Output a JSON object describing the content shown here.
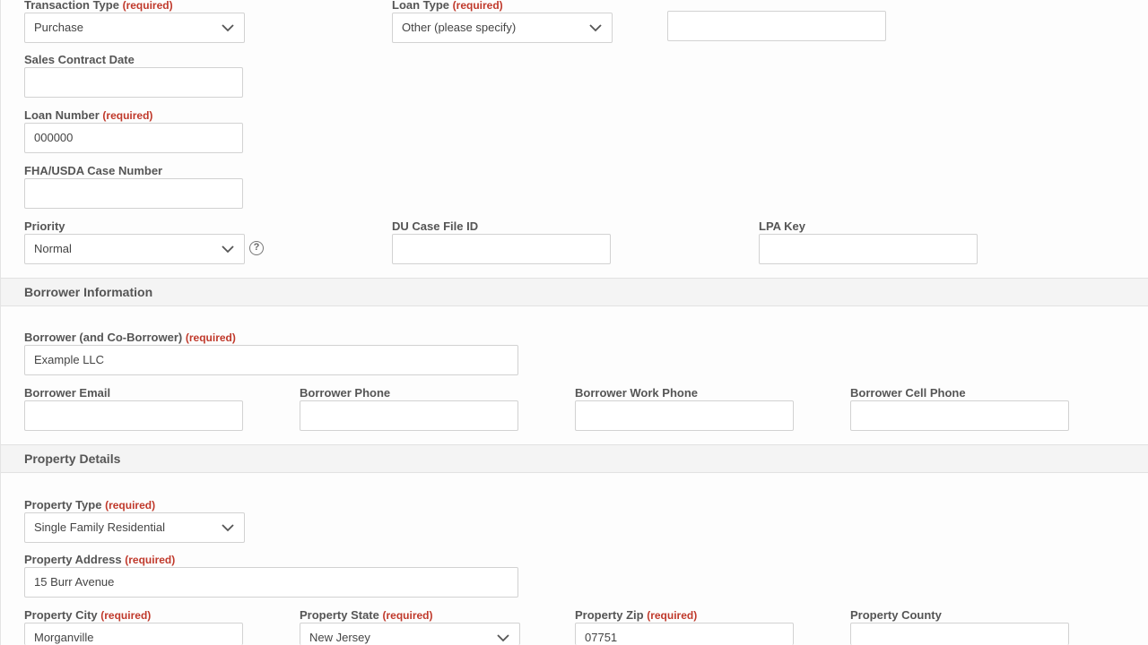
{
  "required_tag": "(required)",
  "loan": {
    "transaction_type": {
      "label": "Transaction Type",
      "value": "Purchase"
    },
    "loan_type": {
      "label": "Loan Type",
      "value": "Other (please specify)",
      "other_value": ""
    },
    "sales_contract_date": {
      "label": "Sales Contract Date",
      "value": ""
    },
    "loan_number": {
      "label": "Loan Number",
      "value": "000000"
    },
    "case_number": {
      "label": "FHA/USDA Case Number",
      "value": ""
    },
    "priority": {
      "label": "Priority",
      "value": "Normal",
      "help_icon": "question-circle-icon",
      "help_glyph": "?"
    },
    "du_case_file": {
      "label": "DU Case File ID",
      "value": ""
    },
    "lpa_key": {
      "label": "LPA Key",
      "value": ""
    }
  },
  "borrower": {
    "section_title": "Borrower Information",
    "name": {
      "label": "Borrower (and Co-Borrower)",
      "value": "Example LLC"
    },
    "email": {
      "label": "Borrower Email",
      "value": ""
    },
    "phone": {
      "label": "Borrower Phone",
      "value": ""
    },
    "work_phone": {
      "label": "Borrower Work Phone",
      "value": ""
    },
    "cell_phone": {
      "label": "Borrower Cell Phone",
      "value": ""
    }
  },
  "property": {
    "section_title": "Property Details",
    "type": {
      "label": "Property Type",
      "value": "Single Family Residential"
    },
    "address": {
      "label": "Property Address",
      "value": "15 Burr Avenue"
    },
    "city": {
      "label": "Property City",
      "value": "Morganville"
    },
    "state": {
      "label": "Property State",
      "value": "New Jersey"
    },
    "zip": {
      "label": "Property Zip",
      "value": "07751"
    },
    "county": {
      "label": "Property County",
      "value": ""
    }
  },
  "icons": {
    "dropdown": "chevron-down-icon"
  },
  "colors": {
    "required": "#c0392b",
    "section_bg": "#f4f4f4",
    "border": "#d2d2d2"
  }
}
